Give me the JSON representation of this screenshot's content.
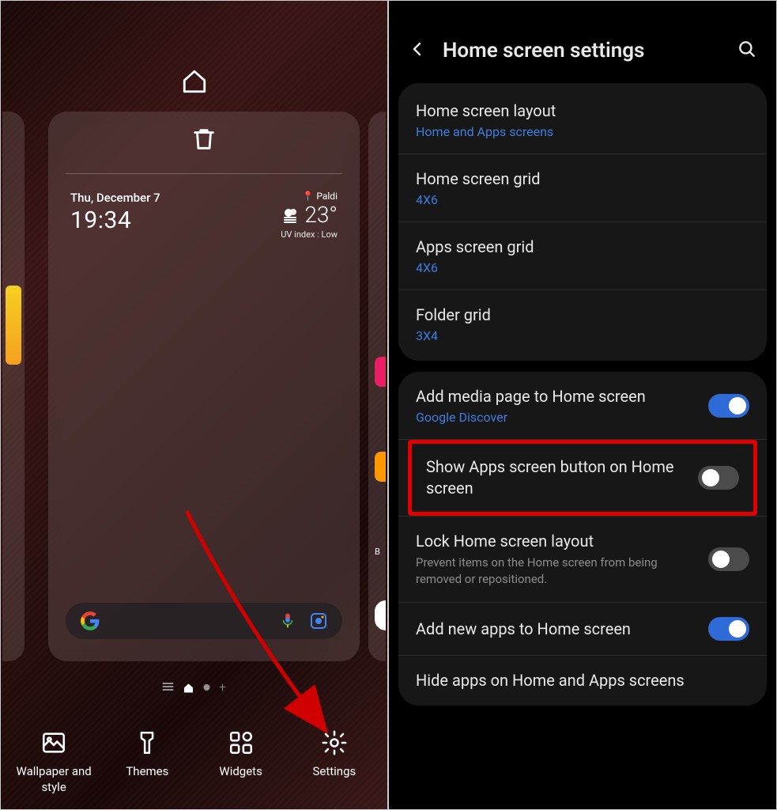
{
  "left": {
    "weather": {
      "date": "Thu, December 7",
      "time": "19:34",
      "location_prefix": "📍",
      "location": "Paldi",
      "temp": "23°",
      "uv": "UV index : Low"
    },
    "tools": {
      "wallpaper": "Wallpaper and style",
      "themes": "Themes",
      "widgets": "Widgets",
      "settings": "Settings"
    }
  },
  "right": {
    "title": "Home screen settings",
    "group1": [
      {
        "title": "Home screen layout",
        "subtitle": "Home and Apps screens"
      },
      {
        "title": "Home screen grid",
        "subtitle": "4X6"
      },
      {
        "title": "Apps screen grid",
        "subtitle": "4X6"
      },
      {
        "title": "Folder grid",
        "subtitle": "3X4"
      }
    ],
    "group2": {
      "media_page": {
        "title": "Add media page to Home screen",
        "subtitle": "Google Discover",
        "toggle": true
      },
      "show_apps": {
        "title": "Show Apps screen button on Home screen",
        "toggle": false
      },
      "lock_layout": {
        "title": "Lock Home screen layout",
        "subtitle": "Prevent items on the Home screen from being removed or repositioned.",
        "toggle": false
      },
      "add_new": {
        "title": "Add new apps to Home screen",
        "toggle": true
      },
      "hide_apps": {
        "title": "Hide apps on Home and Apps screens"
      }
    }
  }
}
